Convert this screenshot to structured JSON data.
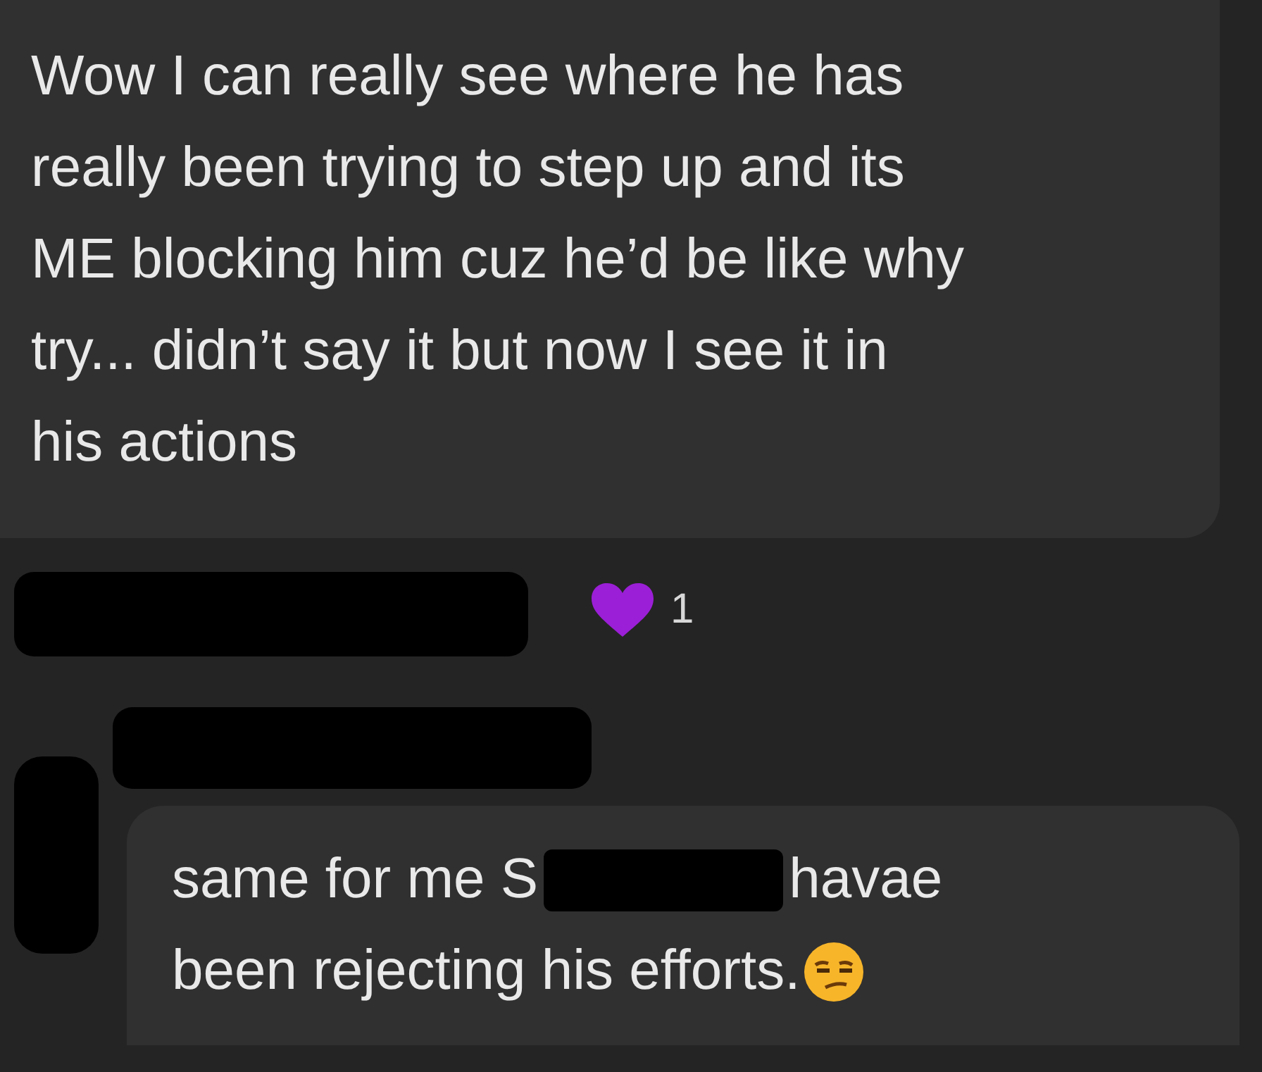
{
  "messages": [
    {
      "kind": "text",
      "lines": [
        "Wow I can really see where he has",
        "really been trying to step up and its",
        "ME blocking him cuz he’d be like why",
        "try... didn’t say it but now I see it in",
        "his actions"
      ]
    },
    {
      "kind": "redacted_reply",
      "before": "same for me S",
      "after": "havae",
      "second_line": "been rejecting his efforts."
    }
  ],
  "reaction": {
    "count": "1"
  }
}
